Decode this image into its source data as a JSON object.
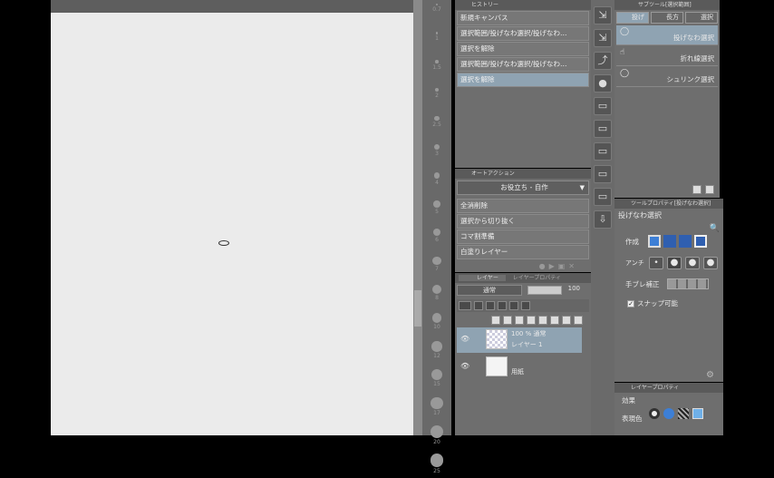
{
  "canvas": {
    "brush_size_labels": [
      "0.7",
      "1",
      "1.5",
      "2",
      "2.5",
      "3",
      "4",
      "5",
      "6",
      "7",
      "8",
      "10",
      "12",
      "15",
      "17",
      "20",
      "25"
    ]
  },
  "history": {
    "title": "ヒストリー",
    "items": [
      "新規キャンバス",
      "選択範囲/投げなわ選択/投げなわ…",
      "選択を解除",
      "選択範囲/投げなわ選択/投げなわ…",
      "選択を解除"
    ],
    "selected_index": 4
  },
  "auto_action": {
    "title": "オートアクション",
    "set_name": "お役立ち - 自作",
    "items": [
      "全消削除",
      "選択から切り抜く",
      "コマ割準備",
      "白塗りレイヤー"
    ]
  },
  "layers": {
    "tab1": "レイヤー",
    "tab2": "レイヤープロパティ",
    "blend_mode": "通常",
    "opacity": "100",
    "items": [
      {
        "line1": "100 % 通常",
        "line2": "レイヤー 1",
        "selected": true
      },
      {
        "line1": "",
        "line2": "用紙",
        "selected": false
      }
    ]
  },
  "subtool": {
    "title": "サブツール[選択範囲]",
    "tabs": [
      "投げ",
      "長方",
      "選択"
    ],
    "items": [
      "投げなわ選択",
      "折れ線選択",
      "シュリンク選択"
    ],
    "selected_index": 0
  },
  "tool_property": {
    "title": "ツールプロパティ[投げなわ選択]",
    "tool_name": "投げなわ選択",
    "mode_label": "作成",
    "antialias_label": "アンチ",
    "stabilizer_label": "手ブレ補正",
    "snap_label": "スナップ可能",
    "snap_checked": true
  },
  "layer_property": {
    "title": "レイヤープロパティ",
    "effect_label": "効果",
    "color_label": "表現色"
  },
  "colors": {
    "selection_blue": "#8fa3b2",
    "panel_gray": "#6e6e6e",
    "canvas": "#ebebeb"
  }
}
